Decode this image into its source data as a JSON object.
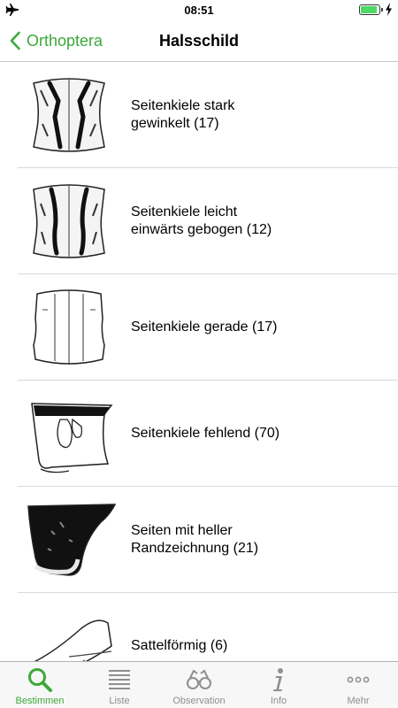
{
  "status_bar": {
    "time": "08:51",
    "left_icon": "airplane-icon",
    "right_icons": [
      "battery-icon",
      "charging-bolt-icon"
    ],
    "battery_level": 0.9
  },
  "nav": {
    "back_label": "Orthoptera",
    "title": "Halsschild"
  },
  "items": [
    {
      "label": "Seitenkiele stark gewinkelt (17)",
      "image": "pronotum-strongly-angled"
    },
    {
      "label": "Seitenkiele leicht einwärts gebogen (12)",
      "image": "pronotum-slightly-curved"
    },
    {
      "label": "Seitenkiele gerade (17)",
      "image": "pronotum-straight"
    },
    {
      "label": "Seitenkiele fehlend (70)",
      "image": "pronotum-keels-absent"
    },
    {
      "label": "Seiten mit heller Randzeichnung (21)",
      "image": "pronotum-light-border"
    },
    {
      "label": "Sattelförmig (6)",
      "image": "pronotum-saddle-shaped"
    }
  ],
  "tabs": [
    {
      "label": "Bestimmen",
      "icon": "search-icon",
      "active": true
    },
    {
      "label": "Liste",
      "icon": "list-icon",
      "active": false
    },
    {
      "label": "Observation",
      "icon": "binoculars-icon",
      "active": false
    },
    {
      "label": "Info",
      "icon": "info-icon",
      "active": false
    },
    {
      "label": "Mehr",
      "icon": "more-icon",
      "active": false
    }
  ],
  "colors": {
    "accent": "#3ea83a",
    "tab_inactive": "#8e8e93",
    "separator": "#d9d9de"
  }
}
